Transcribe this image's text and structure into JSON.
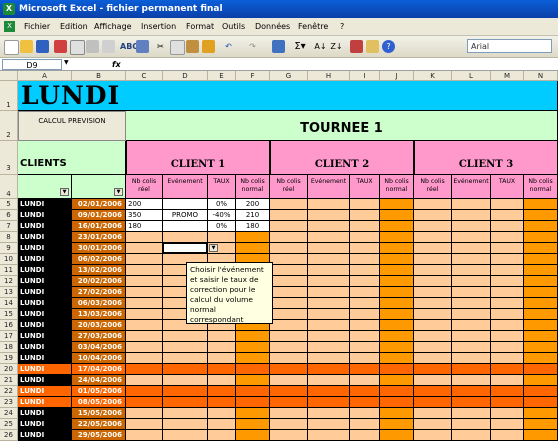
{
  "window": {
    "title": "Microsoft Excel - fichier permanent final"
  },
  "menu": [
    "Fichier",
    "Edition",
    "Affichage",
    "Insertion",
    "Format",
    "Outils",
    "Données",
    "Fenêtre",
    "?"
  ],
  "toolbar": {
    "icons": [
      "new-icon",
      "open-icon",
      "save-icon",
      "permission-icon",
      "email-icon",
      "print-icon",
      "print-preview-icon",
      "spelling-icon",
      "research-icon",
      "cut-icon",
      "copy-icon",
      "paste-icon",
      "format-painter-icon",
      "undo-icon",
      "redo-icon",
      "hyperlink-icon",
      "autosum-icon",
      "sort-ascending-icon",
      "sort-descending-icon",
      "chart-icon",
      "drawing-icon",
      "help-icon"
    ],
    "font": "Arial"
  },
  "formula": {
    "namebox": "D9",
    "fx": "fx",
    "content": ""
  },
  "columns": [
    "A",
    "B",
    "C",
    "D",
    "E",
    "F",
    "G",
    "H",
    "I",
    "J",
    "K",
    "L",
    "M",
    "N"
  ],
  "sheet": {
    "day_title": "LUNDI",
    "calcul_label": "CALCUL PREVISION",
    "tournee": "TOURNEE 1",
    "clients_label": "CLIENTS",
    "client_names": [
      "CLIENT 1",
      "CLIENT 2",
      "CLIENT 3"
    ],
    "subheaders": [
      "Nb colis réel",
      "Evénement",
      "TAUX",
      "Nb colis normal"
    ],
    "rows": [
      {
        "num": "5",
        "day": "LUNDI",
        "date": "02/01/2006",
        "c1": [
          "200",
          "",
          "0%",
          "200"
        ]
      },
      {
        "num": "6",
        "day": "LUNDI",
        "date": "09/01/2006",
        "c1": [
          "350",
          "PROMO",
          "-40%",
          "210"
        ]
      },
      {
        "num": "7",
        "day": "LUNDI",
        "date": "16/01/2006",
        "c1": [
          "180",
          "",
          "0%",
          "180"
        ]
      },
      {
        "num": "8",
        "day": "LUNDI",
        "date": "23/01/2006",
        "c1": [
          "",
          "",
          "",
          ""
        ]
      },
      {
        "num": "9",
        "day": "LUNDI",
        "date": "30/01/2006",
        "c1": [
          "",
          "",
          "",
          ""
        ]
      },
      {
        "num": "10",
        "day": "LUNDI",
        "date": "06/02/2006",
        "c1": [
          "",
          "",
          "",
          ""
        ]
      },
      {
        "num": "11",
        "day": "LUNDI",
        "date": "13/02/2006",
        "c1": [
          "",
          "",
          "",
          ""
        ]
      },
      {
        "num": "12",
        "day": "LUNDI",
        "date": "20/02/2006",
        "c1": [
          "",
          "",
          "",
          ""
        ]
      },
      {
        "num": "13",
        "day": "LUNDI",
        "date": "27/02/2006",
        "c1": [
          "",
          "",
          "",
          ""
        ]
      },
      {
        "num": "14",
        "day": "LUNDI",
        "date": "06/03/2006",
        "c1": [
          "",
          "",
          "",
          ""
        ]
      },
      {
        "num": "15",
        "day": "LUNDI",
        "date": "13/03/2006",
        "c1": [
          "",
          "",
          "",
          ""
        ]
      },
      {
        "num": "16",
        "day": "LUNDI",
        "date": "20/03/2006",
        "c1": [
          "",
          "",
          "",
          ""
        ]
      },
      {
        "num": "17",
        "day": "LUNDI",
        "date": "27/03/2006",
        "c1": [
          "",
          "",
          "",
          ""
        ]
      },
      {
        "num": "18",
        "day": "LUNDI",
        "date": "03/04/2006",
        "c1": [
          "",
          "",
          "",
          ""
        ]
      },
      {
        "num": "19",
        "day": "LUNDI",
        "date": "10/04/2006",
        "c1": [
          "",
          "",
          "",
          ""
        ]
      },
      {
        "num": "20",
        "day": "LUNDI",
        "date": "17/04/2006",
        "c1": [
          "",
          "",
          "",
          ""
        ]
      },
      {
        "num": "21",
        "day": "LUNDI",
        "date": "24/04/2006",
        "c1": [
          "",
          "",
          "",
          ""
        ]
      },
      {
        "num": "22",
        "day": "LUNDI",
        "date": "01/05/2006",
        "c1": [
          "",
          "",
          "",
          ""
        ]
      },
      {
        "num": "23",
        "day": "LUNDI",
        "date": "08/05/2006",
        "c1": [
          "",
          "",
          "",
          ""
        ]
      },
      {
        "num": "24",
        "day": "LUNDI",
        "date": "15/05/2006",
        "c1": [
          "",
          "",
          "",
          ""
        ]
      },
      {
        "num": "25",
        "day": "LUNDI",
        "date": "22/05/2006",
        "c1": [
          "",
          "",
          "",
          ""
        ]
      },
      {
        "num": "26",
        "day": "LUNDI",
        "date": "29/05/2006",
        "c1": [
          "",
          "",
          "",
          ""
        ]
      }
    ],
    "holiday_rows": [
      "17/04/2006",
      "01/05/2006",
      "08/05/2006"
    ]
  },
  "tooltip": "Choisir l'événement et saisir le taux de correction pour le calcul du volume normal correspondant",
  "colors": {
    "title_cyan": "#00ccff",
    "light_green": "#ccffcc",
    "pink": "#ff99cc",
    "peach": "#ffcc99",
    "orange": "#ff9900",
    "holiday_orange": "#ff6600",
    "date_cell": "#cc6600"
  }
}
